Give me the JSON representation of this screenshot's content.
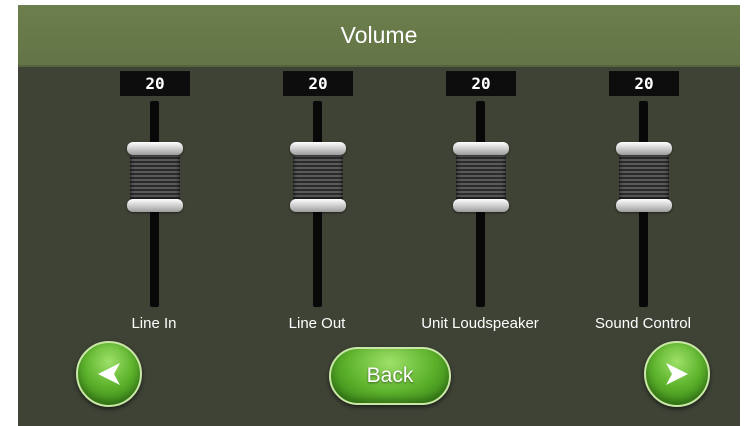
{
  "header": {
    "title": "Volume"
  },
  "channels": [
    {
      "label": "Line In",
      "value": "20",
      "level": 0.63
    },
    {
      "label": "Line Out",
      "value": "20",
      "level": 0.63
    },
    {
      "label": "Unit Loudspeaker",
      "value": "20",
      "level": 0.63
    },
    {
      "label": "Sound Control",
      "value": "20",
      "level": 0.63
    }
  ],
  "nav": {
    "back_label": "Back",
    "prev_icon": "left-arrow-icon",
    "next_icon": "right-arrow-icon"
  },
  "colors": {
    "titlebar": "#667848",
    "background": "#3e4336",
    "button_green": "#5fb52d"
  }
}
